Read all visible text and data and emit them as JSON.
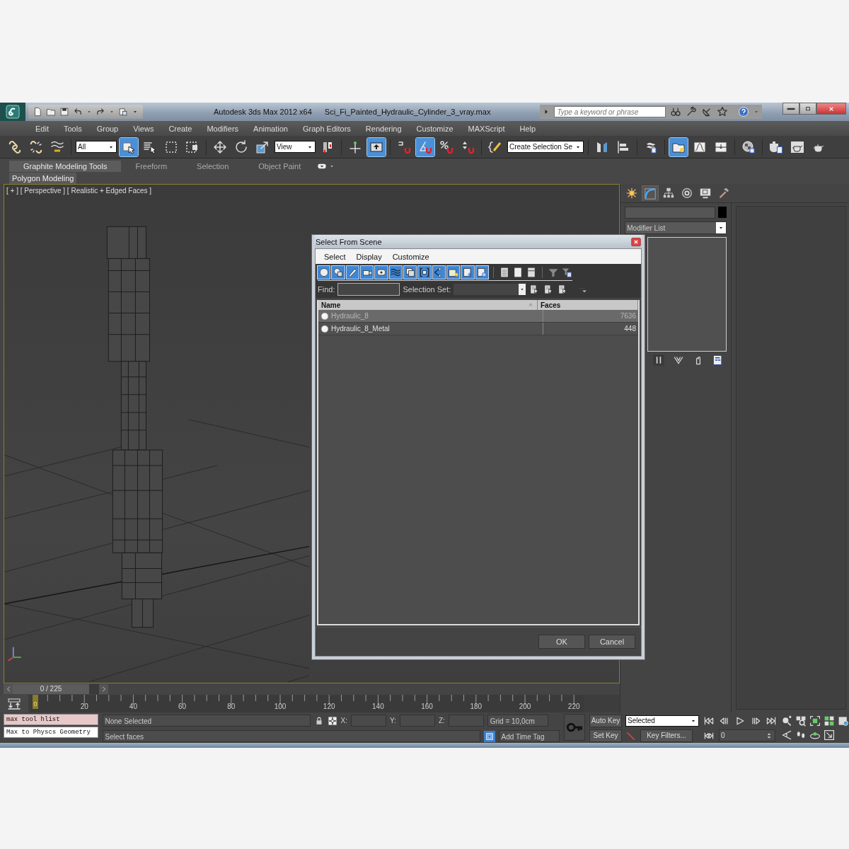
{
  "window": {
    "app_title": "Autodesk 3ds Max 2012 x64",
    "file_title": "Sci_Fi_Painted_Hydraulic_Cylinder_3_vray.max"
  },
  "search": {
    "placeholder": "Type a keyword or phrase"
  },
  "menu": [
    "Edit",
    "Tools",
    "Group",
    "Views",
    "Create",
    "Modifiers",
    "Animation",
    "Graph Editors",
    "Rendering",
    "Customize",
    "MAXScript",
    "Help"
  ],
  "toolbar": [
    {
      "kind": "button",
      "on": false
    },
    {
      "kind": "button",
      "on": false
    },
    {
      "kind": "button",
      "on": false
    },
    {
      "kind": "separator"
    },
    {
      "kind": "dropdown",
      "value": "All"
    },
    {
      "kind": "button",
      "on": true
    },
    {
      "kind": "button",
      "on": false
    },
    {
      "kind": "button",
      "on": false
    },
    {
      "kind": "button",
      "on": false
    },
    {
      "kind": "separator"
    },
    {
      "kind": "button",
      "on": false
    },
    {
      "kind": "button",
      "on": false
    },
    {
      "kind": "button",
      "on": false
    },
    {
      "kind": "dropdown",
      "value": "View"
    },
    {
      "kind": "button",
      "on": false
    },
    {
      "kind": "separator"
    },
    {
      "kind": "button",
      "on": false
    },
    {
      "kind": "button",
      "on": true
    },
    {
      "kind": "separator"
    },
    {
      "kind": "button",
      "on": false
    },
    {
      "kind": "button",
      "on": true
    },
    {
      "kind": "button",
      "on": false
    },
    {
      "kind": "button",
      "on": false
    },
    {
      "kind": "separator"
    },
    {
      "kind": "button",
      "on": false
    },
    {
      "kind": "dropdown",
      "value": "Create Selection Se"
    },
    {
      "kind": "separator"
    },
    {
      "kind": "button",
      "on": false
    },
    {
      "kind": "button",
      "on": false
    },
    {
      "kind": "separator"
    },
    {
      "kind": "button",
      "on": false
    },
    {
      "kind": "separator"
    },
    {
      "kind": "button",
      "on": true
    },
    {
      "kind": "button",
      "on": false
    },
    {
      "kind": "button",
      "on": false
    },
    {
      "kind": "separator"
    },
    {
      "kind": "button",
      "on": false
    },
    {
      "kind": "separator"
    },
    {
      "kind": "button",
      "on": false
    },
    {
      "kind": "button",
      "on": false
    },
    {
      "kind": "button",
      "on": false
    }
  ],
  "ribbon": {
    "tabs": [
      {
        "label": "Graphite Modeling Tools",
        "selected": true
      },
      {
        "label": "Freeform",
        "selected": false
      },
      {
        "label": "Selection",
        "selected": false
      },
      {
        "label": "Object Paint",
        "selected": false
      }
    ],
    "panel": "Polygon Modeling"
  },
  "viewport": {
    "label": "[ + ] [ Perspective ] [ Realistic + Edged Faces ]"
  },
  "dialog": {
    "title": "Select From Scene",
    "menu": [
      "Select",
      "Display",
      "Customize"
    ],
    "filters": [
      {
        "on": true
      },
      {
        "on": true
      },
      {
        "on": true
      },
      {
        "on": true
      },
      {
        "on": true
      },
      {
        "on": true
      },
      {
        "on": true
      },
      {
        "on": true
      },
      {
        "on": true
      },
      {
        "on": true
      },
      {
        "on": true
      },
      {
        "on": true
      }
    ],
    "find_label": "Find:",
    "selection_set_label": "Selection Set:",
    "columns": [
      "Name",
      "Faces"
    ],
    "rows": [
      {
        "name": "Hydraulic_8",
        "faces": "7636",
        "selected": true
      },
      {
        "name": "Hydraulic_8_Metal",
        "faces": "448",
        "selected": false
      }
    ],
    "buttons": [
      "OK",
      "Cancel"
    ]
  },
  "command_panel": {
    "tabs": [
      {
        "selected": false
      },
      {
        "selected": true
      },
      {
        "selected": false
      },
      {
        "selected": false
      },
      {
        "selected": false
      },
      {
        "selected": false
      }
    ],
    "modifier_list": "Modifier List"
  },
  "time_slider": {
    "label": "0 / 225",
    "level": 0
  },
  "track_bar": {
    "current": "0",
    "ticks": [
      "20",
      "40",
      "60",
      "80",
      "100",
      "120",
      "140",
      "160",
      "180",
      "200",
      "220"
    ]
  },
  "status": {
    "listener": [
      "max tool hlist",
      "Max to Physcs Geometry"
    ],
    "selection": "None Selected",
    "prompt": "Select faces",
    "coords": [
      "X:",
      "Y:",
      "Z:"
    ],
    "grid": "Grid = 10,0cm",
    "time_tag": "Add Time Tag",
    "auto_key": "Auto Key",
    "set_key": "Set Key",
    "key_mode": "Selected",
    "key_filters": "Key Filters...",
    "frame": "0"
  }
}
